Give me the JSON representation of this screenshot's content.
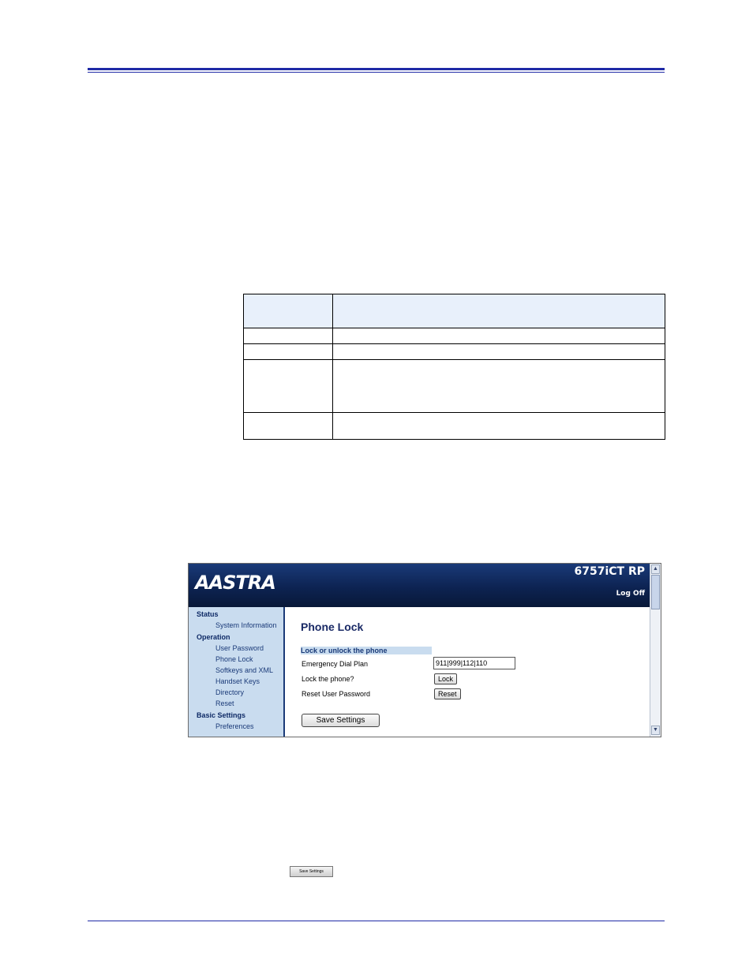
{
  "screenshot": {
    "brand": "AASTRA",
    "model": "6757iCT RP",
    "logoff": "Log Off",
    "nav": {
      "status_label": "Status",
      "system_information": "System Information",
      "operation_label": "Operation",
      "user_password": "User Password",
      "phone_lock": "Phone Lock",
      "softkeys_xml": "Softkeys and XML",
      "handset_keys": "Handset Keys",
      "directory": "Directory",
      "reset": "Reset",
      "basic_settings_label": "Basic Settings",
      "preferences": "Preferences"
    },
    "main": {
      "title": "Phone Lock",
      "section": "Lock or unlock the phone",
      "emergency_label": "Emergency Dial Plan",
      "emergency_value": "911|999|112|110",
      "lock_label": "Lock the phone?",
      "lock_button": "Lock",
      "reset_label": "Reset User Password",
      "reset_button": "Reset",
      "save_button": "Save Settings"
    }
  },
  "inline_button": "Save Settings"
}
